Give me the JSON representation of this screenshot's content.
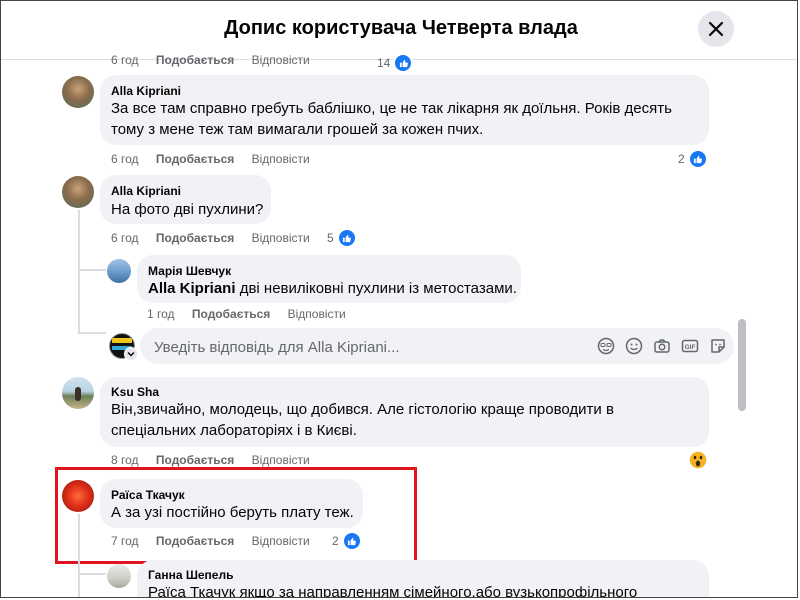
{
  "header": {
    "title": "Допис користувача Четверта влада"
  },
  "top_cut": {
    "time": "6 год",
    "like": "Подобається",
    "reply": "Відповісти",
    "reactions": "14"
  },
  "comments": [
    {
      "author": "Alla Kipriani",
      "text_lines": [
        "За все там справно гребуть баблішко, це не так лікарня як доїльня. Років десять",
        "тому з мене теж там вимагали грошей за кожен пчих."
      ],
      "time": "6 год",
      "like": "Подобається",
      "reply": "Відповісти",
      "reactions": "2"
    },
    {
      "author": "Alla Kipriani",
      "text": "На фото дві пухлини?",
      "time": "6 год",
      "like": "Подобається",
      "reply": "Відповісти",
      "reactions": "5"
    },
    {
      "author": "Ksu Sha",
      "text_lines": [
        "Він,звичайно, молодець, що добився. Але гістологію краще проводити в",
        "спеціальних лабораторіях і в Києві."
      ],
      "time": "8 год",
      "like": "Подобається",
      "reply": "Відповісти",
      "reaction_icon": "wow-emoji-icon"
    },
    {
      "author": "Раїса Ткачук",
      "text": "А за узі постійно беруть плату теж.",
      "time": "7 год",
      "like": "Подобається",
      "reply": "Відповісти",
      "reactions": "2"
    }
  ],
  "reply_maria": {
    "author": "Марія Шевчук",
    "mention": "Alla Kipriani",
    "text": "дві невиліковні пухлини із метостазами.",
    "time": "1 год",
    "like": "Подобається",
    "reply": "Відповісти"
  },
  "reply_input": {
    "placeholder": "Уведіть відповідь для Alla Kipriani..."
  },
  "reply_ganna": {
    "author": "Ганна Шепель",
    "text": "Раїса Ткачук якщо за направленням сімейного,або вузькопрофільного"
  },
  "colors": {
    "like_blue": "#1877f2",
    "highlight_red": "#e0141e",
    "bubble_bg": "#f0f2f5",
    "meta_gray": "#65676b"
  }
}
